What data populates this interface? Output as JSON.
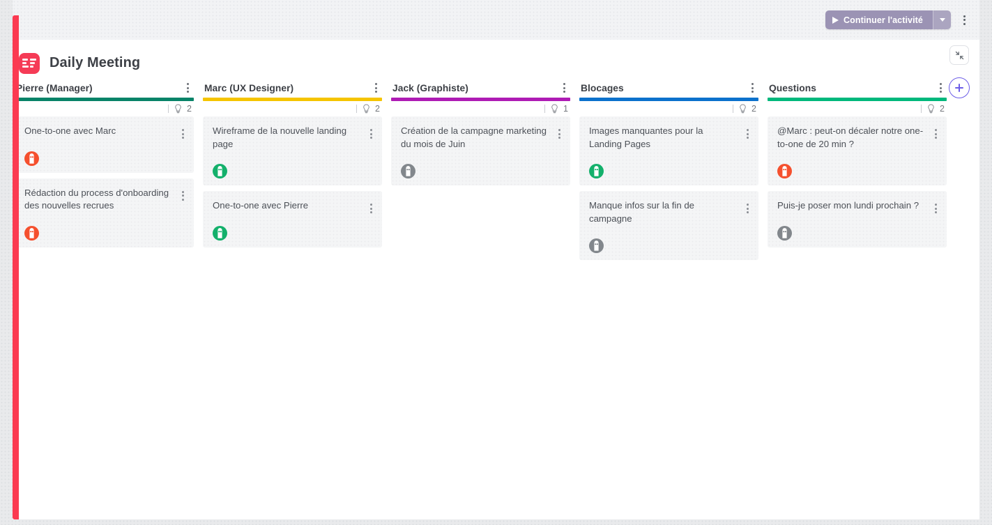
{
  "toolbar": {
    "primary_button_label": "Continuer l'activité",
    "primary_button_icon": "play-icon",
    "dropdown_icon": "chevron-down-icon",
    "overflow_icon": "kebab-menu-icon"
  },
  "board": {
    "title": "Daily Meeting",
    "app_icon": "board-logo-icon",
    "accent_color": "#f53b56",
    "side_actions": {
      "expand_icon": "collapse-diagonal-icon",
      "add_label": "+",
      "add_icon": "plus-icon",
      "add_color": "#6b5ce7"
    }
  },
  "columns": [
    {
      "title": "Pierre (Manager)",
      "color": "#078368",
      "count": "2",
      "count_icon": "lightbulb-icon",
      "menu_icon": "kebab-menu-icon",
      "cards": [
        {
          "text": "One-to-one avec Marc",
          "avatar": "avatar-pierre",
          "avatar_color": "#f5502e",
          "menu_icon": "kebab-menu-icon"
        },
        {
          "text": "Rédaction du process d'onboarding des nouvelles recrues",
          "avatar": "avatar-pierre",
          "avatar_color": "#f5502e",
          "menu_icon": "kebab-menu-icon"
        }
      ]
    },
    {
      "title": "Marc (UX Designer)",
      "color": "#f5c400",
      "count": "2",
      "count_icon": "lightbulb-icon",
      "menu_icon": "kebab-menu-icon",
      "cards": [
        {
          "text": "Wireframe de la nouvelle landing page",
          "avatar": "avatar-marc",
          "avatar_color": "#13b06b",
          "menu_icon": "kebab-menu-icon"
        },
        {
          "text": "One-to-one avec Pierre",
          "avatar": "avatar-marc",
          "avatar_color": "#13b06b",
          "menu_icon": "kebab-menu-icon"
        }
      ]
    },
    {
      "title": "Jack (Graphiste)",
      "color": "#ae1bb4",
      "count": "1",
      "count_icon": "lightbulb-icon",
      "menu_icon": "kebab-menu-icon",
      "cards": [
        {
          "text": "Création de la campagne marketing du mois de Juin",
          "avatar": "avatar-jack",
          "avatar_color": "#82878c",
          "menu_icon": "kebab-menu-icon"
        }
      ]
    },
    {
      "title": "Blocages",
      "color": "#0b71cc",
      "count": "2",
      "count_icon": "lightbulb-icon",
      "menu_icon": "kebab-menu-icon",
      "cards": [
        {
          "text": "Images manquantes pour la Landing Pages",
          "avatar": "avatar-marc",
          "avatar_color": "#13b06b",
          "menu_icon": "kebab-menu-icon"
        },
        {
          "text": "Manque infos sur la fin de campagne",
          "avatar": "avatar-jack",
          "avatar_color": "#82878c",
          "menu_icon": "kebab-menu-icon"
        }
      ]
    },
    {
      "title": "Questions",
      "color": "#00b87c",
      "count": "2",
      "count_icon": "lightbulb-icon",
      "menu_icon": "kebab-menu-icon",
      "cards": [
        {
          "text": "@Marc : peut-on décaler notre one-to-one de 20 min ?",
          "avatar": "avatar-pierre",
          "avatar_color": "#f5502e",
          "menu_icon": "kebab-menu-icon"
        },
        {
          "text": "Puis-je poser mon lundi prochain ?",
          "avatar": "avatar-jack",
          "avatar_color": "#82878c",
          "menu_icon": "kebab-menu-icon"
        }
      ]
    }
  ]
}
